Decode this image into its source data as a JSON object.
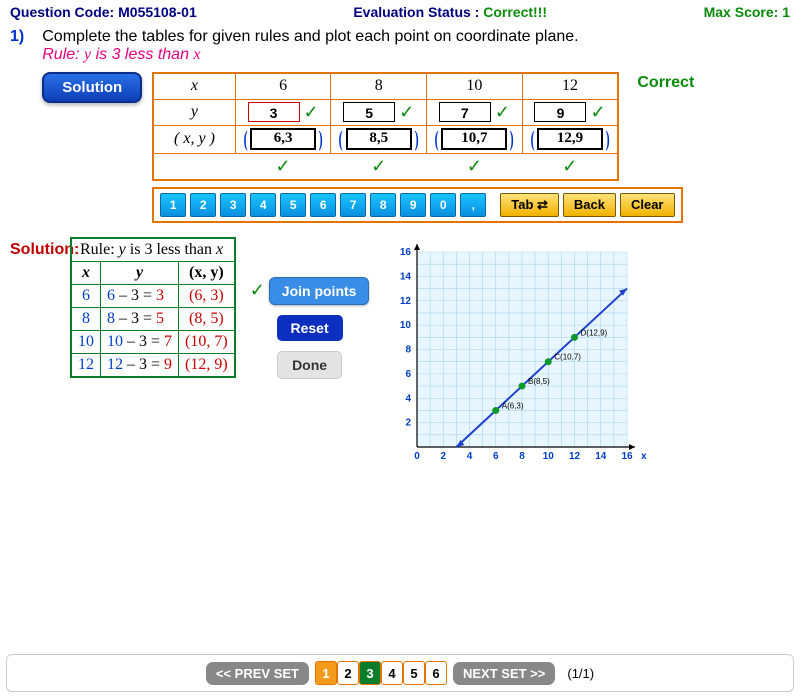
{
  "header": {
    "qcode_label": "Question Code: ",
    "qcode": "M055108-01",
    "eval_label": "Evaluation Status :  ",
    "eval_status": "Correct!!!",
    "max_score_label": "Max Score: ",
    "max_score": "1"
  },
  "question": {
    "number": "1)",
    "text": "Complete the tables for given rules and plot each point on coordinate plane.",
    "rule_pre": "Rule: ",
    "rule_y": "y",
    "rule_mid": " is 3 less than ",
    "rule_x": "x",
    "solution_btn": "Solution",
    "correct_tag": "Correct"
  },
  "table": {
    "hx": "x",
    "hy": "y",
    "hp": "( x, y )",
    "x": [
      "6",
      "8",
      "10",
      "12"
    ],
    "y": [
      "3",
      "5",
      "7",
      "9"
    ],
    "p": [
      "6,3",
      "8,5",
      "10,7",
      "12,9"
    ]
  },
  "keypad": [
    "1",
    "2",
    "3",
    "4",
    "5",
    "6",
    "7",
    "8",
    "9",
    "0",
    ","
  ],
  "keypad_actions": {
    "tab": "Tab ⇄",
    "back": "Back",
    "clear": "Clear"
  },
  "solution_label": "Solution:",
  "sol_table": {
    "title_pre": "Rule: ",
    "title_y": "y",
    "title_mid": " is 3 less than ",
    "title_x": "x",
    "hx": "x",
    "hy": "y",
    "hp": "(x, y)",
    "rows": [
      {
        "x": "6",
        "a": "6",
        "b": "3",
        "r": "3",
        "p": "(6, 3)"
      },
      {
        "x": "8",
        "a": "8",
        "b": "3",
        "r": "5",
        "p": "(8, 5)"
      },
      {
        "x": "10",
        "a": "10",
        "b": "3",
        "r": "7",
        "p": "(10, 7)"
      },
      {
        "x": "12",
        "a": "12",
        "b": "3",
        "r": "9",
        "p": "(12, 9)"
      }
    ]
  },
  "buttons": {
    "join": "Join points",
    "reset": "Reset",
    "done": "Done"
  },
  "chart_data": {
    "type": "scatter",
    "xlabel": "x",
    "xlim": [
      0,
      16
    ],
    "ylim": [
      0,
      16
    ],
    "xticks": [
      0,
      2,
      4,
      6,
      8,
      10,
      12,
      14,
      16
    ],
    "yticks": [
      2,
      4,
      6,
      8,
      10,
      12,
      14,
      16
    ],
    "points": [
      {
        "x": 6,
        "y": 3,
        "label": "A(6,3)"
      },
      {
        "x": 8,
        "y": 5,
        "label": "B(8,5)"
      },
      {
        "x": 10,
        "y": 7,
        "label": "C(10,7)"
      },
      {
        "x": 12,
        "y": 9,
        "label": "D(12,9)"
      }
    ],
    "line": {
      "x1": 3,
      "y1": 0,
      "x2": 16,
      "y2": 13
    }
  },
  "footer": {
    "prev": "<< PREV SET",
    "next": "NEXT SET >>",
    "pages": [
      "1",
      "2",
      "3",
      "4",
      "5",
      "6"
    ],
    "active": 0,
    "green": 2,
    "count": "(1/1)"
  }
}
